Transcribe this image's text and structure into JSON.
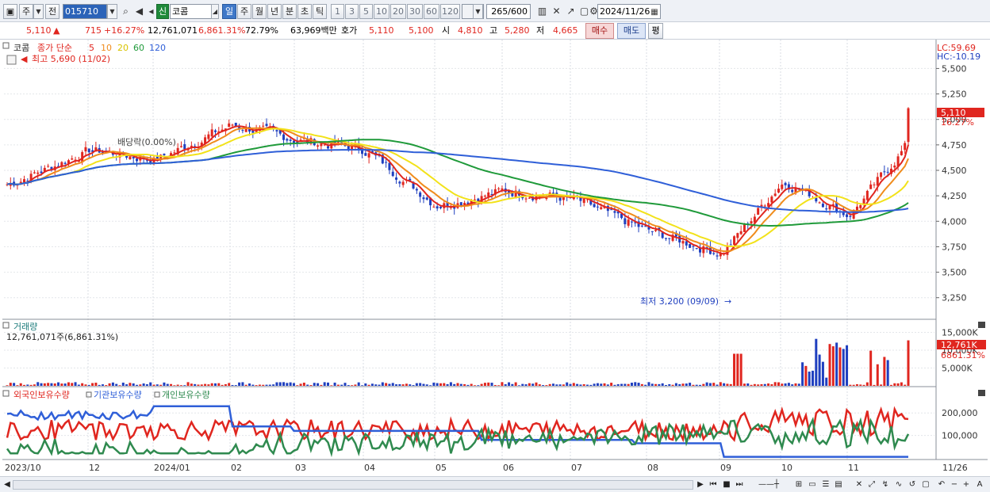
{
  "toolbar": {
    "period_label": "주",
    "prev_label": "전",
    "stock_code": "015710",
    "credit_badge": "신",
    "stock_name": "코콤",
    "intervals": [
      "일",
      "주",
      "월",
      "년",
      "분",
      "초",
      "틱"
    ],
    "active_interval": "일",
    "ticks": [
      "1",
      "3",
      "5",
      "10",
      "20",
      "30",
      "60",
      "120"
    ],
    "count_display": "265/600",
    "date_value": "2024/11/26"
  },
  "quote": {
    "price": "5,110",
    "price_arrow": "▲",
    "change": "715",
    "change_pct": "+16.27%",
    "volume": "12,761,071",
    "volume_pct": "6,861.31%",
    "turnover_pct": "72.79%",
    "amount": "63,969백만",
    "hoga_label": "호가",
    "ask": "5,110",
    "bid": "5,100",
    "open_label": "시",
    "open": "4,810",
    "high_label": "고",
    "high": "5,280",
    "low_label": "저",
    "low": "4,665",
    "buy_label": "매수",
    "sell_label": "매도",
    "avg_label": "평"
  },
  "price_panel": {
    "stock_tag": "코콤",
    "ma_label": "종가 단순",
    "ma_periods": [
      {
        "label": "5",
        "color": "#e0261f"
      },
      {
        "label": "10",
        "color": "#f08c1c"
      },
      {
        "label": "20",
        "color": "#f2e21a"
      },
      {
        "label": "60",
        "color": "#1f9a3a"
      },
      {
        "label": "120",
        "color": "#2f5fd8"
      }
    ],
    "high_note": "최고 5,690 (11/02)",
    "low_note": "최저 3,200 (09/09)",
    "dividend_note": "배당락(0.00%)",
    "lc_label": "LC:59.69",
    "hc_label": "HC:-10.19",
    "current_price_tag": "5,110",
    "current_pct_tag": "16.27%",
    "y_ticks": [
      "5,500",
      "5,250",
      "5,000",
      "4,750",
      "4,500",
      "4,250",
      "4,000",
      "3,750",
      "3,500",
      "3,250"
    ]
  },
  "volume_panel": {
    "title": "거래량",
    "summary": "12,761,071주(6,861.31%)",
    "y_ticks": [
      "15,000K",
      "10,000K",
      "5,000K"
    ],
    "current_tag": "12,761K",
    "current_pct_tag": "6861.31%"
  },
  "holder_panel": {
    "legend": [
      {
        "label": "외국인보유수량",
        "color": "#e0261f"
      },
      {
        "label": "기관보유수량",
        "color": "#2f5fd8"
      },
      {
        "label": "개인보유수량",
        "color": "#2f8a4f"
      }
    ],
    "y_ticks": [
      "200,000",
      "100,000"
    ]
  },
  "x_axis": {
    "labels": [
      "2023/10",
      "12",
      "2024/01",
      "02",
      "03",
      "04",
      "05",
      "06",
      "07",
      "08",
      "09",
      "10",
      "11"
    ],
    "end_label": "11/26"
  },
  "chart_data": [
    {
      "type": "candlestick",
      "title": "코콤",
      "x_range": [
        "2023/10",
        "2024/11/26"
      ],
      "ylim": [
        3100,
        5690
      ],
      "monthly_close_approx": [
        {
          "x": "2023/10",
          "value": 4350
        },
        {
          "x": "2023/11",
          "value": 4700
        },
        {
          "x": "2023/12",
          "value": 4600
        },
        {
          "x": "2024/01",
          "value": 4950
        },
        {
          "x": "2024/02",
          "value": 4800
        },
        {
          "x": "2024/03",
          "value": 4700
        },
        {
          "x": "2024/04",
          "value": 4150
        },
        {
          "x": "2024/05",
          "value": 4300
        },
        {
          "x": "2024/06",
          "value": 4220
        },
        {
          "x": "2024/07",
          "value": 3900
        },
        {
          "x": "2024/08",
          "value": 3680
        },
        {
          "x": "2024/09",
          "value": 4400
        },
        {
          "x": "2024/10",
          "value": 4050
        },
        {
          "x": "2024/11",
          "value": 4800
        },
        {
          "x": "2024/11/26",
          "value": 5110
        }
      ],
      "series": [
        {
          "name": "5",
          "color": "#e0261f"
        },
        {
          "name": "10",
          "color": "#f08c1c"
        },
        {
          "name": "20",
          "color": "#f2e21a"
        },
        {
          "name": "60",
          "color": "#1f9a3a"
        },
        {
          "name": "120",
          "color": "#2f5fd8"
        }
      ],
      "annotations": [
        "최고 5,690 (11/02)",
        "최저 3,200 (09/09)",
        "배당락(0.00%)"
      ]
    },
    {
      "type": "bar",
      "title": "거래량",
      "ylim": [
        0,
        16000000
      ],
      "last_value": 12761071
    },
    {
      "type": "line",
      "ylim": [
        0,
        250000
      ],
      "series": [
        {
          "name": "외국인보유수량",
          "color": "#e0261f"
        },
        {
          "name": "기관보유수량",
          "color": "#2f5fd8"
        },
        {
          "name": "개인보유수량",
          "color": "#2f8a4f"
        }
      ]
    }
  ]
}
